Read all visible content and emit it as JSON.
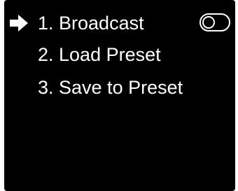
{
  "menu": {
    "items": [
      {
        "label": "1. Broadcast",
        "selected": true,
        "toggle_on": false
      },
      {
        "label": "2. Load Preset"
      },
      {
        "label": "3. Save to Preset"
      }
    ],
    "cursor_icon": "arrow-right-icon",
    "toggle_icon": "toggle-switch-icon"
  },
  "colors": {
    "background": "#000000",
    "text": "#ffffff"
  }
}
